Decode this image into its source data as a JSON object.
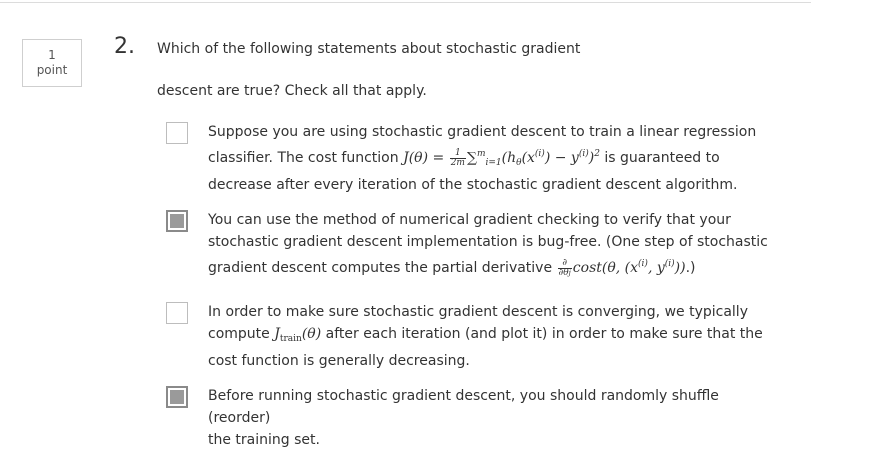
{
  "points": {
    "value": "1",
    "label": "point"
  },
  "question": {
    "number": "2.",
    "prompt_line1": "Which of the following statements about stochastic gradient",
    "prompt_line2": "descent are true? Check all that apply."
  },
  "options": [
    {
      "checked": false,
      "line1": "Suppose you are using stochastic gradient descent to train a linear regression",
      "line2_pre": "classifier. The cost function",
      "line2_post": "is guaranteed to",
      "line3": "decrease after every iteration of the stochastic gradient descent algorithm."
    },
    {
      "checked": true,
      "line1": "You can use the method of numerical gradient checking to verify that your",
      "line2": "stochastic gradient descent implementation is bug-free. (One step of stochastic",
      "line3_pre": "gradient descent computes the partial derivative",
      "line3_post": ".)"
    },
    {
      "checked": false,
      "line1": "In order to make sure stochastic gradient descent is converging, we typically",
      "line2_pre": "compute",
      "line2_post": "after each iteration (and plot it) in order to make sure that the",
      "line3": "cost function is generally decreasing."
    },
    {
      "checked": true,
      "line1": "Before running stochastic gradient descent, you should randomly shuffle (reorder)",
      "line2": "the training set."
    }
  ],
  "colors": {
    "text": "#333333",
    "checkbox_fill": "#9a9a9a",
    "border": "#cfcfcf"
  }
}
